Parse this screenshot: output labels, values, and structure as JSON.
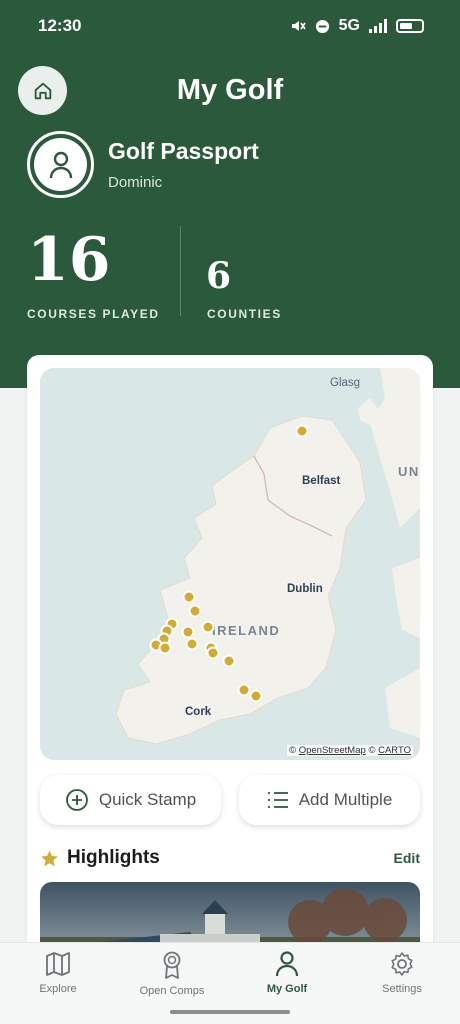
{
  "status_bar": {
    "time": "12:30",
    "network": "5G"
  },
  "header": {
    "title": "My Golf"
  },
  "passport": {
    "title": "Golf Passport",
    "user": "Dominic"
  },
  "stats": [
    {
      "value": "16",
      "label": "COURSES PLAYED"
    },
    {
      "value": "6",
      "label": "COUNTIES"
    }
  ],
  "map": {
    "labels": {
      "country": "IRELAND",
      "belfast": "Belfast",
      "dublin": "Dublin",
      "cork": "Cork",
      "glasgow": "Glasg",
      "uk": "UN"
    },
    "attribution": {
      "prefix": "©",
      "osm": "OpenStreetMap",
      "mid": "©",
      "carto": "CARTO"
    },
    "marker_color": "#d4ab2f"
  },
  "actions": {
    "quick_stamp": "Quick Stamp",
    "add_multiple": "Add Multiple"
  },
  "highlights": {
    "title": "Highlights",
    "edit": "Edit"
  },
  "tabs": [
    {
      "label": "Explore",
      "icon": "map-icon"
    },
    {
      "label": "Open Comps",
      "icon": "award-icon"
    },
    {
      "label": "My Golf",
      "icon": "person-icon",
      "active": true
    },
    {
      "label": "Settings",
      "icon": "gear-icon"
    }
  ],
  "colors": {
    "brand": "#2a5a3b",
    "accent": "#d4ab2f"
  }
}
